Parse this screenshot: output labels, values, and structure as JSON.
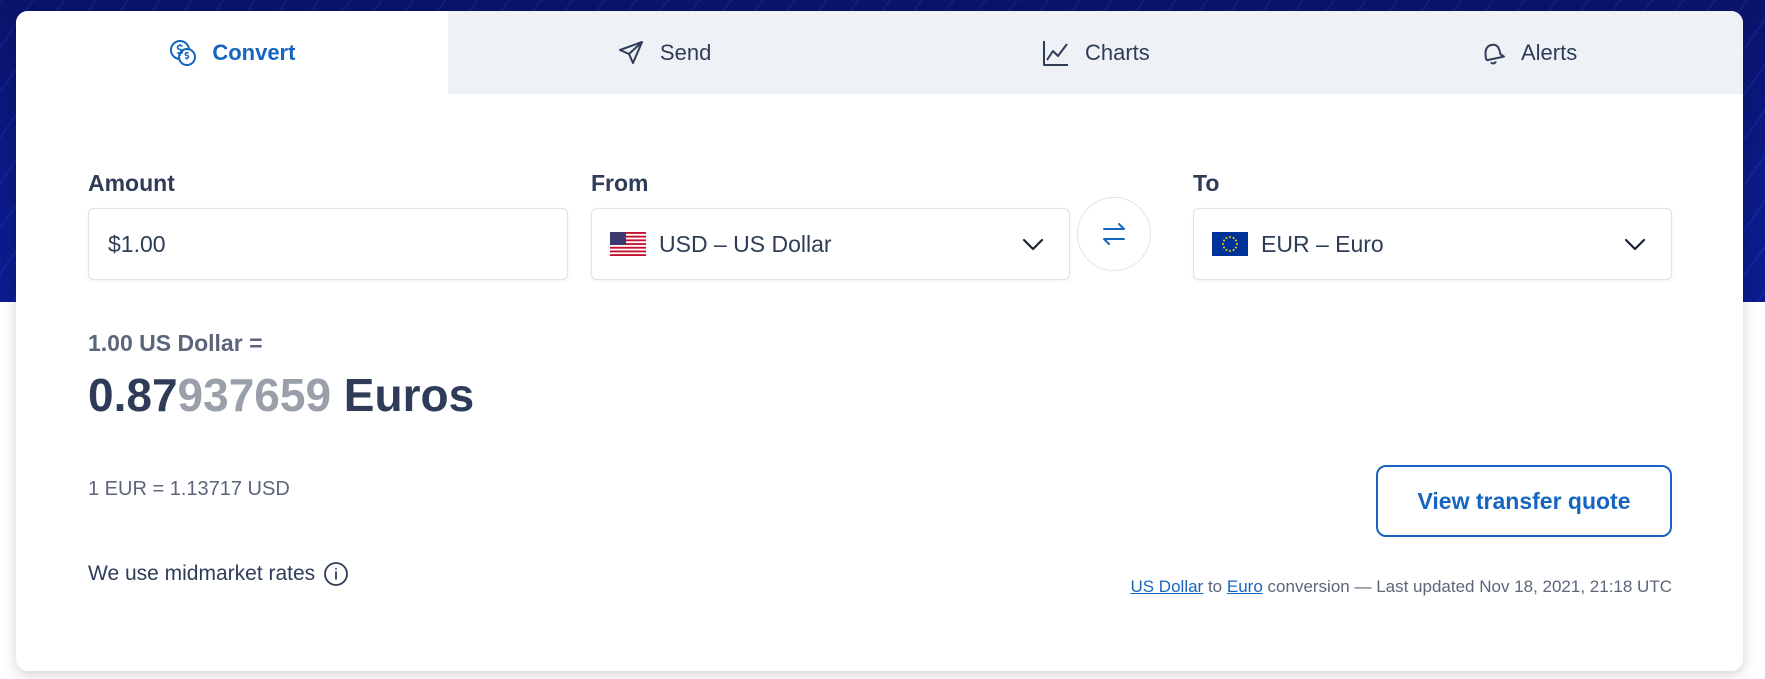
{
  "tabs": [
    {
      "label": "Convert",
      "icon": "coins-icon",
      "active": true
    },
    {
      "label": "Send",
      "icon": "send-icon",
      "active": false
    },
    {
      "label": "Charts",
      "icon": "chart-icon",
      "active": false
    },
    {
      "label": "Alerts",
      "icon": "bell-icon",
      "active": false
    }
  ],
  "form": {
    "amount_label": "Amount",
    "amount_value": "$1.00",
    "from_label": "From",
    "from_value": "USD – US Dollar",
    "from_flag": "us-flag-icon",
    "to_label": "To",
    "to_value": "EUR – Euro",
    "to_flag": "eu-flag-icon"
  },
  "result": {
    "from_line": "1.00 US Dollar =",
    "value_main": "0.87",
    "value_dim": "937659",
    "currency": " Euros",
    "inverse_rate": "1 EUR = 1.13717 USD",
    "midmarket_note": "We use midmarket rates"
  },
  "quote_button": "View transfer quote",
  "footer": {
    "from_link": "US Dollar",
    "to_word": "to",
    "to_link": "Euro",
    "suffix": "conversion — Last updated Nov 18, 2021, 21:18 UTC"
  },
  "colors": {
    "accent": "#1565c0",
    "hero_bg": "#0b1a86",
    "text": "#2e3c57"
  }
}
